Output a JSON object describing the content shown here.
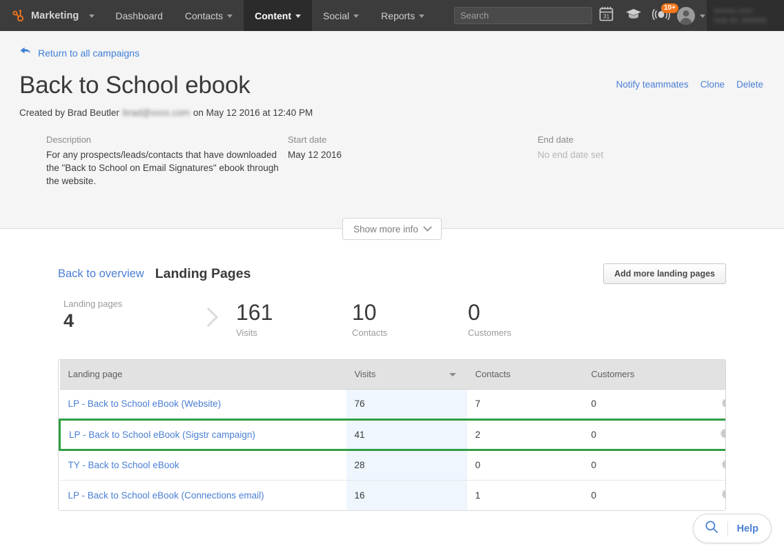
{
  "navbar": {
    "brand": {
      "label": "Marketing",
      "icon": "hubspot-sprocket-logo"
    },
    "items": [
      {
        "label": "Dashboard",
        "has_caret": false,
        "active": false
      },
      {
        "label": "Contacts",
        "has_caret": true,
        "active": false
      },
      {
        "label": "Content",
        "has_caret": true,
        "active": true
      },
      {
        "label": "Social",
        "has_caret": true,
        "active": false
      },
      {
        "label": "Reports",
        "has_caret": true,
        "active": false
      }
    ],
    "search_placeholder": "Search",
    "calendar_day": "31",
    "notification_badge": "10+",
    "account_line1": "xxxxxx.com",
    "account_line2": "Hub ID: 000000"
  },
  "campaign": {
    "return_link": "Return to all campaigns",
    "title": "Back to School ebook",
    "created_prefix": "Created by Brad Beutler",
    "created_email": "brad@xxxx.com",
    "created_suffix": "on May 12 2016 at 12:40 PM",
    "actions": [
      "Notify teammates",
      "Clone",
      "Delete"
    ],
    "description_label": "Description",
    "description_value": "For any prospects/leads/contacts that have downloaded the \"Back to School on Email Signatures\" ebook through the website.",
    "start_date_label": "Start date",
    "start_date_value": "May 12 2016",
    "end_date_label": "End date",
    "end_date_value": "No end date set",
    "show_more_label": "Show more info"
  },
  "section": {
    "back_to_overview": "Back to overview",
    "title": "Landing Pages",
    "add_button": "Add more landing pages"
  },
  "stats": {
    "primary_label": "Landing pages",
    "primary_value": "4",
    "items": [
      {
        "value": "161",
        "label": "Visits"
      },
      {
        "value": "10",
        "label": "Contacts"
      },
      {
        "value": "0",
        "label": "Customers"
      }
    ]
  },
  "table": {
    "columns": [
      "Landing page",
      "Visits",
      "Contacts",
      "Customers"
    ],
    "sorted_by": "Visits",
    "rows": [
      {
        "page": "LP - Back to School eBook (Website)",
        "visits": "76",
        "contacts": "7",
        "customers": "0",
        "highlighted": false
      },
      {
        "page": "LP - Back to School eBook (Sigstr campaign)",
        "visits": "41",
        "contacts": "2",
        "customers": "0",
        "highlighted": true
      },
      {
        "page": "TY - Back to School eBook",
        "visits": "28",
        "contacts": "0",
        "customers": "0",
        "highlighted": false
      },
      {
        "page": "LP - Back to School eBook (Connections email)",
        "visits": "16",
        "contacts": "1",
        "customers": "0",
        "highlighted": false
      }
    ]
  },
  "help": {
    "label": "Help",
    "icon": "magnifier-icon"
  },
  "colors": {
    "navbar_bg": "#3c3c3c",
    "nav_active_bg": "#2b2b2b",
    "link_blue": "#4a7fd4",
    "badge_orange": "#f5761a",
    "highlight_green": "#2f9e44",
    "header_bg": "#f5f5f5",
    "visits_col_bg": "#eff6fd"
  }
}
